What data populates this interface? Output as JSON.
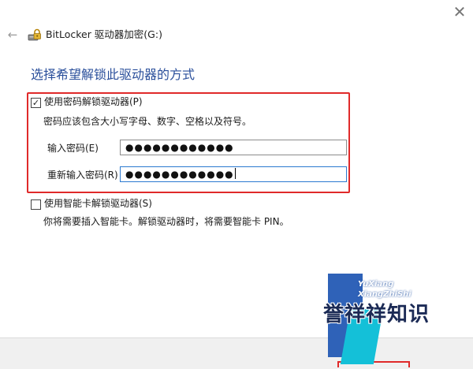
{
  "window": {
    "title": "BitLocker 驱动器加密(G:)",
    "close_glyph": "✕",
    "back_glyph": "←"
  },
  "heading": "选择希望解锁此驱动器的方式",
  "password_option": {
    "checked": true,
    "label": "使用密码解锁驱动器(P)",
    "hint": "密码应该包含大小写字母、数字、空格以及符号。",
    "enter_label": "输入密码(E)",
    "enter_value": "●●●●●●●●●●●●",
    "reenter_label": "重新输入密码(R)",
    "reenter_value": "●●●●●●●●●●●●"
  },
  "smartcard_option": {
    "checked": false,
    "label": "使用智能卡解锁驱动器(S)",
    "hint": "你将需要插入智能卡。解锁驱动器时，将需要智能卡 PIN。"
  },
  "watermark": {
    "latin_line1": "YuXiang",
    "latin_line2": "XiangZhiShi",
    "cn_text": "誉祥祥知识"
  },
  "colors": {
    "heading_blue": "#2a4f9b",
    "highlight_red": "#e02a2a",
    "input_focus_blue": "#2b79d0"
  },
  "icons": {
    "title_icon": "bitlocker-drive-icon",
    "close": "close-icon",
    "back": "back-arrow-icon"
  }
}
